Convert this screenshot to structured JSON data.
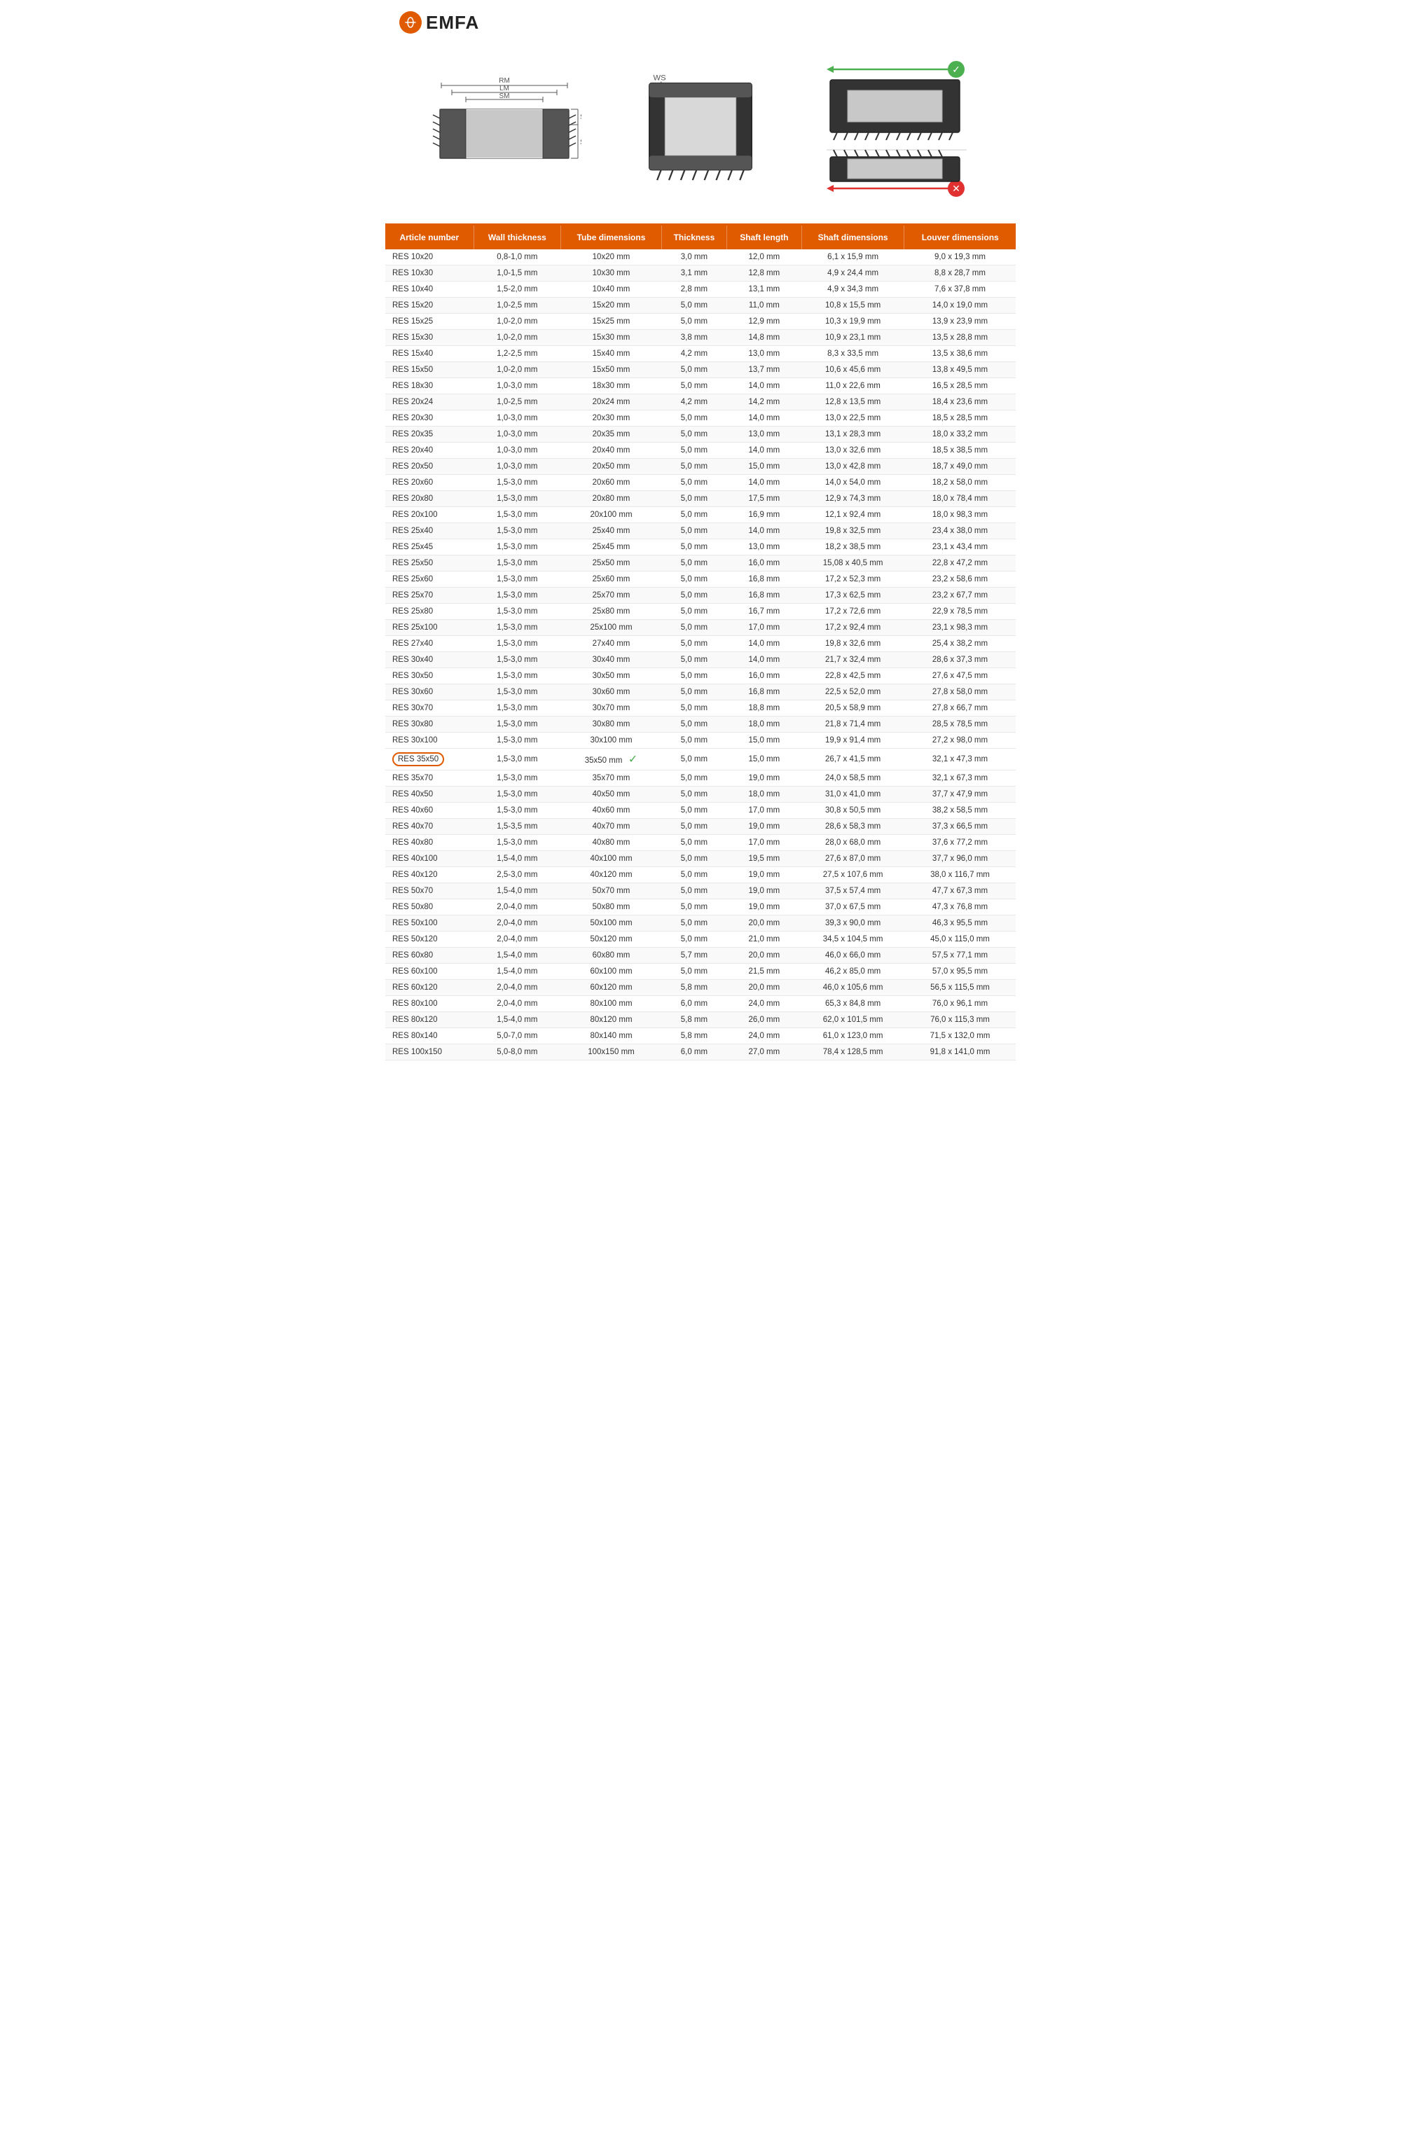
{
  "logo": {
    "circle_text": "●",
    "brand": "EMFA"
  },
  "diagrams": {
    "labels": {
      "rm": "RM",
      "lm": "LM",
      "sm": "SM",
      "sk": "SK",
      "se": "SE",
      "ws": "WS"
    }
  },
  "table": {
    "headers": [
      "Article number",
      "Wall thickness",
      "Tube dimensions",
      "Thickness",
      "Shaft length",
      "Shaft dimensions",
      "Louver dimensions"
    ],
    "rows": [
      [
        "RES 10x20",
        "0,8-1,0 mm",
        "10x20 mm",
        "3,0 mm",
        "12,0 mm",
        "6,1 x 15,9 mm",
        "9,0 x 19,3 mm"
      ],
      [
        "RES 10x30",
        "1,0-1,5 mm",
        "10x30 mm",
        "3,1 mm",
        "12,8 mm",
        "4,9 x 24,4 mm",
        "8,8 x 28,7 mm"
      ],
      [
        "RES 10x40",
        "1,5-2,0 mm",
        "10x40 mm",
        "2,8 mm",
        "13,1 mm",
        "4,9 x 34,3 mm",
        "7,6 x 37,8 mm"
      ],
      [
        "RES 15x20",
        "1,0-2,5 mm",
        "15x20 mm",
        "5,0 mm",
        "11,0 mm",
        "10,8 x 15,5 mm",
        "14,0 x 19,0 mm"
      ],
      [
        "RES 15x25",
        "1,0-2,0 mm",
        "15x25 mm",
        "5,0 mm",
        "12,9 mm",
        "10,3 x 19,9 mm",
        "13,9 x 23,9 mm"
      ],
      [
        "RES 15x30",
        "1,0-2,0 mm",
        "15x30 mm",
        "3,8 mm",
        "14,8 mm",
        "10,9 x 23,1 mm",
        "13,5 x 28,8 mm"
      ],
      [
        "RES 15x40",
        "1,2-2,5 mm",
        "15x40 mm",
        "4,2 mm",
        "13,0 mm",
        "8,3 x 33,5 mm",
        "13,5 x 38,6 mm"
      ],
      [
        "RES 15x50",
        "1,0-2,0 mm",
        "15x50 mm",
        "5,0 mm",
        "13,7 mm",
        "10,6 x 45,6 mm",
        "13,8 x 49,5 mm"
      ],
      [
        "RES 18x30",
        "1,0-3,0 mm",
        "18x30 mm",
        "5,0 mm",
        "14,0 mm",
        "11,0 x 22,6 mm",
        "16,5 x 28,5 mm"
      ],
      [
        "RES 20x24",
        "1,0-2,5 mm",
        "20x24 mm",
        "4,2 mm",
        "14,2 mm",
        "12,8 x 13,5 mm",
        "18,4 x 23,6 mm"
      ],
      [
        "RES 20x30",
        "1,0-3,0 mm",
        "20x30 mm",
        "5,0 mm",
        "14,0 mm",
        "13,0 x 22,5 mm",
        "18,5 x 28,5 mm"
      ],
      [
        "RES 20x35",
        "1,0-3,0 mm",
        "20x35 mm",
        "5,0 mm",
        "13,0 mm",
        "13,1 x 28,3 mm",
        "18,0 x 33,2 mm"
      ],
      [
        "RES 20x40",
        "1,0-3,0 mm",
        "20x40 mm",
        "5,0 mm",
        "14,0 mm",
        "13,0 x 32,6 mm",
        "18,5 x 38,5 mm"
      ],
      [
        "RES 20x50",
        "1,0-3,0 mm",
        "20x50 mm",
        "5,0 mm",
        "15,0 mm",
        "13,0 x 42,8 mm",
        "18,7 x 49,0 mm"
      ],
      [
        "RES 20x60",
        "1,5-3,0 mm",
        "20x60 mm",
        "5,0 mm",
        "14,0 mm",
        "14,0 x 54,0 mm",
        "18,2 x 58,0 mm"
      ],
      [
        "RES 20x80",
        "1,5-3,0 mm",
        "20x80 mm",
        "5,0 mm",
        "17,5 mm",
        "12,9 x 74,3 mm",
        "18,0 x 78,4 mm"
      ],
      [
        "RES 20x100",
        "1,5-3,0 mm",
        "20x100 mm",
        "5,0 mm",
        "16,9 mm",
        "12,1 x 92,4 mm",
        "18,0 x 98,3 mm"
      ],
      [
        "RES 25x40",
        "1,5-3,0 mm",
        "25x40 mm",
        "5,0 mm",
        "14,0 mm",
        "19,8 x 32,5 mm",
        "23,4 x 38,0 mm"
      ],
      [
        "RES 25x45",
        "1,5-3,0 mm",
        "25x45 mm",
        "5,0 mm",
        "13,0 mm",
        "18,2 x 38,5 mm",
        "23,1 x 43,4 mm"
      ],
      [
        "RES 25x50",
        "1,5-3,0 mm",
        "25x50 mm",
        "5,0 mm",
        "16,0 mm",
        "15,08 x 40,5 mm",
        "22,8 x 47,2 mm"
      ],
      [
        "RES 25x60",
        "1,5-3,0 mm",
        "25x60 mm",
        "5,0 mm",
        "16,8 mm",
        "17,2 x 52,3 mm",
        "23,2 x 58,6 mm"
      ],
      [
        "RES 25x70",
        "1,5-3,0 mm",
        "25x70 mm",
        "5,0 mm",
        "16,8 mm",
        "17,3 x 62,5 mm",
        "23,2 x 67,7 mm"
      ],
      [
        "RES 25x80",
        "1,5-3,0 mm",
        "25x80 mm",
        "5,0 mm",
        "16,7 mm",
        "17,2 x 72,6 mm",
        "22,9 x 78,5 mm"
      ],
      [
        "RES 25x100",
        "1,5-3,0 mm",
        "25x100 mm",
        "5,0 mm",
        "17,0 mm",
        "17,2 x 92,4 mm",
        "23,1 x 98,3 mm"
      ],
      [
        "RES 27x40",
        "1,5-3,0 mm",
        "27x40 mm",
        "5,0 mm",
        "14,0 mm",
        "19,8 x 32,6 mm",
        "25,4 x 38,2 mm"
      ],
      [
        "RES 30x40",
        "1,5-3,0 mm",
        "30x40 mm",
        "5,0 mm",
        "14,0 mm",
        "21,7 x 32,4 mm",
        "28,6 x 37,3 mm"
      ],
      [
        "RES 30x50",
        "1,5-3,0 mm",
        "30x50 mm",
        "5,0 mm",
        "16,0 mm",
        "22,8 x 42,5 mm",
        "27,6 x 47,5 mm"
      ],
      [
        "RES 30x60",
        "1,5-3,0 mm",
        "30x60 mm",
        "5,0 mm",
        "16,8 mm",
        "22,5 x 52,0 mm",
        "27,8 x 58,0 mm"
      ],
      [
        "RES 30x70",
        "1,5-3,0 mm",
        "30x70 mm",
        "5,0 mm",
        "18,8 mm",
        "20,5 x 58,9 mm",
        "27,8 x 66,7 mm"
      ],
      [
        "RES 30x80",
        "1,5-3,0 mm",
        "30x80 mm",
        "5,0 mm",
        "18,0 mm",
        "21,8 x 71,4 mm",
        "28,5 x 78,5 mm"
      ],
      [
        "RES 30x100",
        "1,5-3,0 mm",
        "30x100 mm",
        "5,0 mm",
        "15,0 mm",
        "19,9 x 91,4 mm",
        "27,2 x 98,0 mm"
      ],
      [
        "RES 35x50",
        "1,5-3,0 mm",
        "35x50 mm",
        "5,0 mm",
        "15,0 mm",
        "26,7 x 41,5 mm",
        "32,1 x 47,3 mm",
        true
      ],
      [
        "RES 35x70",
        "1,5-3,0 mm",
        "35x70 mm",
        "5,0 mm",
        "19,0 mm",
        "24,0 x 58,5 mm",
        "32,1 x 67,3 mm"
      ],
      [
        "RES 40x50",
        "1,5-3,0 mm",
        "40x50 mm",
        "5,0 mm",
        "18,0 mm",
        "31,0 x 41,0 mm",
        "37,7 x 47,9 mm"
      ],
      [
        "RES 40x60",
        "1,5-3,0 mm",
        "40x60 mm",
        "5,0 mm",
        "17,0 mm",
        "30,8 x 50,5 mm",
        "38,2 x 58,5 mm"
      ],
      [
        "RES 40x70",
        "1,5-3,5 mm",
        "40x70 mm",
        "5,0 mm",
        "19,0 mm",
        "28,6 x 58,3 mm",
        "37,3 x 66,5 mm"
      ],
      [
        "RES 40x80",
        "1,5-3,0 mm",
        "40x80 mm",
        "5,0 mm",
        "17,0 mm",
        "28,0 x 68,0 mm",
        "37,6 x 77,2 mm"
      ],
      [
        "RES 40x100",
        "1,5-4,0 mm",
        "40x100 mm",
        "5,0 mm",
        "19,5 mm",
        "27,6 x 87,0 mm",
        "37,7 x 96,0 mm"
      ],
      [
        "RES 40x120",
        "2,5-3,0 mm",
        "40x120 mm",
        "5,0 mm",
        "19,0 mm",
        "27,5 x 107,6 mm",
        "38,0 x 116,7 mm"
      ],
      [
        "RES 50x70",
        "1,5-4,0 mm",
        "50x70 mm",
        "5,0 mm",
        "19,0 mm",
        "37,5 x 57,4 mm",
        "47,7 x 67,3 mm"
      ],
      [
        "RES 50x80",
        "2,0-4,0 mm",
        "50x80 mm",
        "5,0 mm",
        "19,0 mm",
        "37,0 x 67,5 mm",
        "47,3 x 76,8 mm"
      ],
      [
        "RES 50x100",
        "2,0-4,0 mm",
        "50x100 mm",
        "5,0 mm",
        "20,0 mm",
        "39,3 x 90,0 mm",
        "46,3 x 95,5 mm"
      ],
      [
        "RES 50x120",
        "2,0-4,0 mm",
        "50x120 mm",
        "5,0 mm",
        "21,0 mm",
        "34,5 x 104,5 mm",
        "45,0 x 115,0 mm"
      ],
      [
        "RES 60x80",
        "1,5-4,0 mm",
        "60x80 mm",
        "5,7 mm",
        "20,0 mm",
        "46,0 x 66,0 mm",
        "57,5 x 77,1 mm"
      ],
      [
        "RES 60x100",
        "1,5-4,0 mm",
        "60x100 mm",
        "5,0 mm",
        "21,5 mm",
        "46,2 x 85,0 mm",
        "57,0 x 95,5 mm"
      ],
      [
        "RES 60x120",
        "2,0-4,0 mm",
        "60x120 mm",
        "5,8 mm",
        "20,0 mm",
        "46,0 x 105,6 mm",
        "56,5 x 115,5 mm"
      ],
      [
        "RES 80x100",
        "2,0-4,0 mm",
        "80x100 mm",
        "6,0 mm",
        "24,0 mm",
        "65,3 x 84,8 mm",
        "76,0 x 96,1 mm"
      ],
      [
        "RES 80x120",
        "1,5-4,0 mm",
        "80x120 mm",
        "5,8 mm",
        "26,0 mm",
        "62,0 x 101,5 mm",
        "76,0 x 115,3 mm"
      ],
      [
        "RES 80x140",
        "5,0-7,0 mm",
        "80x140 mm",
        "5,8 mm",
        "24,0 mm",
        "61,0 x 123,0 mm",
        "71,5 x 132,0 mm"
      ],
      [
        "RES 100x150",
        "5,0-8,0 mm",
        "100x150 mm",
        "6,0 mm",
        "27,0 mm",
        "78,4 x 128,5 mm",
        "91,8 x 141,0 mm"
      ]
    ]
  }
}
